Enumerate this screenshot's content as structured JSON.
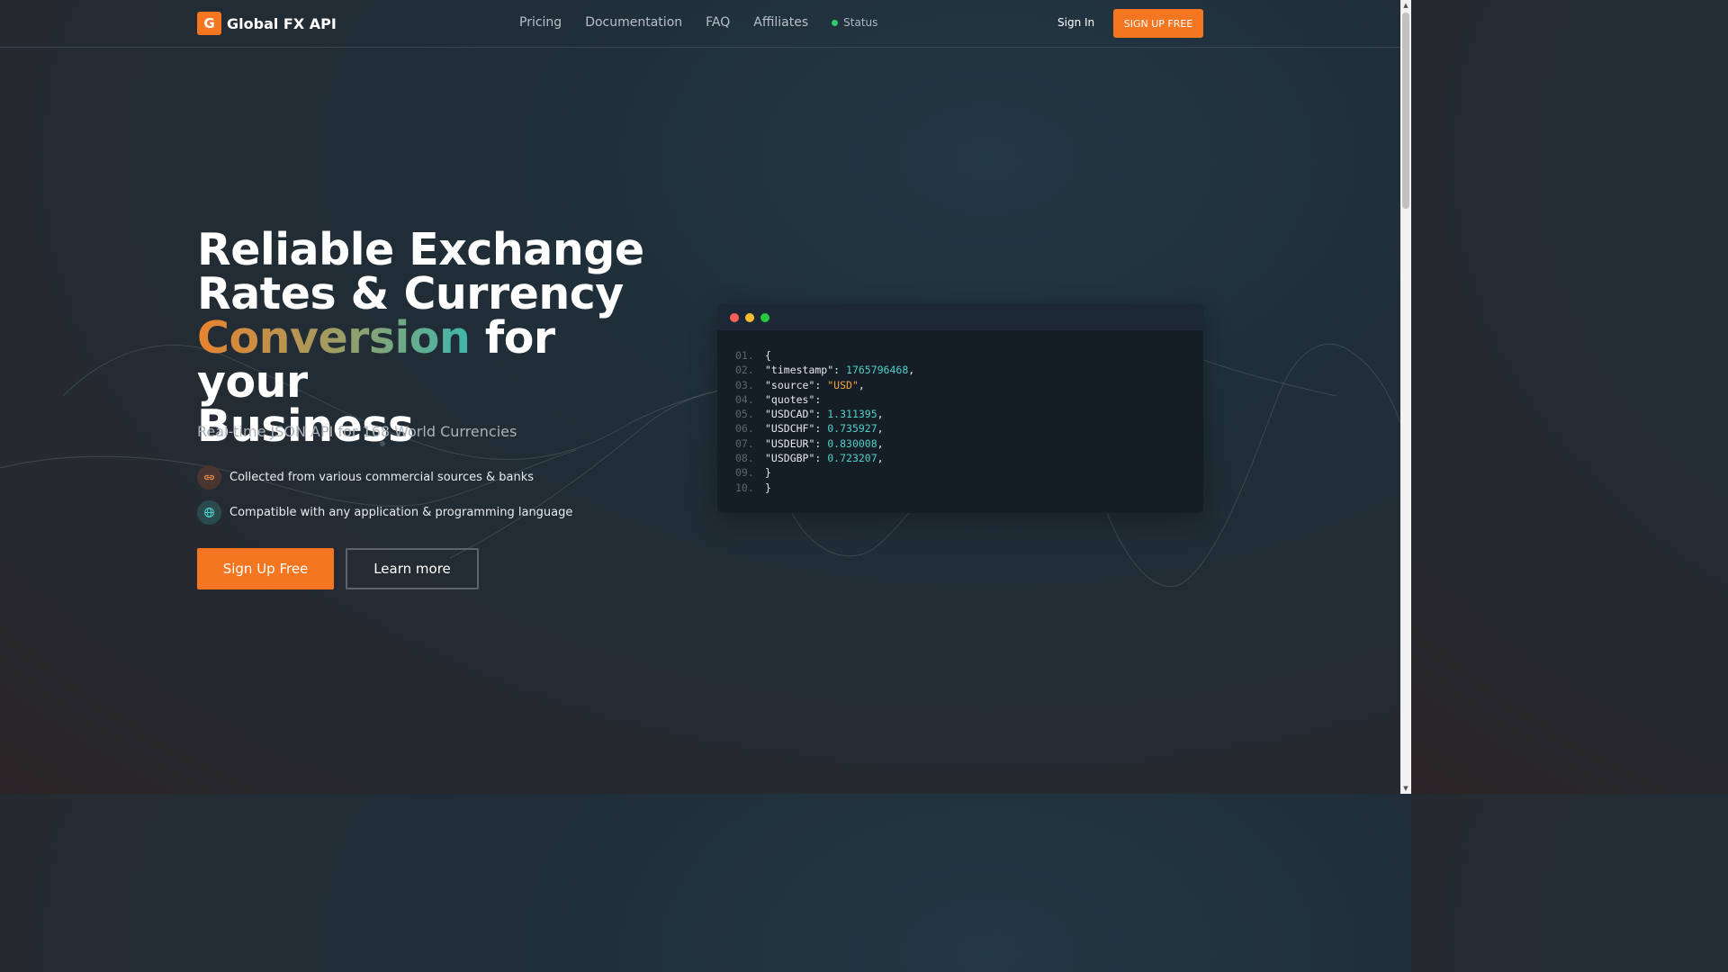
{
  "brand": {
    "logo_letter": "G",
    "name": "Global FX API",
    "accent": "#f47621"
  },
  "nav": {
    "items": [
      {
        "label": "Pricing"
      },
      {
        "label": "Documentation"
      },
      {
        "label": "FAQ"
      },
      {
        "label": "Affiliates"
      }
    ],
    "status_label": "Status",
    "status_color": "#2ecc71",
    "sign_in": "Sign In",
    "sign_up": "SIGN UP FREE"
  },
  "hero": {
    "title_line1": "Reliable Exchange",
    "title_line2": "Rates & Currency",
    "title_highlight": "Conversion",
    "title_line3_rest": " for your",
    "title_line4": "Business",
    "subtitle": "Real-time JSON API for 168 World Currencies",
    "features": [
      {
        "icon": "link-icon",
        "text": "Collected from various commercial sources & banks"
      },
      {
        "icon": "globe-icon",
        "text": "Compatible with any application & programming language"
      }
    ],
    "primary_button": "Sign Up Free",
    "secondary_button": "Learn more"
  },
  "code": {
    "lines": [
      {
        "n": "01.",
        "parts": [
          [
            "text",
            "{"
          ]
        ]
      },
      {
        "n": "02.",
        "parts": [
          [
            "text",
            "\"timestamp\": "
          ],
          [
            "num",
            "1765796468"
          ],
          [
            "text",
            ","
          ]
        ]
      },
      {
        "n": "03.",
        "parts": [
          [
            "text",
            "\"source\": "
          ],
          [
            "str",
            "\"USD\""
          ],
          [
            "text",
            ","
          ]
        ]
      },
      {
        "n": "04.",
        "parts": [
          [
            "text",
            "\"quotes\":"
          ]
        ]
      },
      {
        "n": "05.",
        "parts": [
          [
            "text",
            "\"USDCAD\": "
          ],
          [
            "num",
            "1.311395"
          ],
          [
            "text",
            ","
          ]
        ]
      },
      {
        "n": "06.",
        "parts": [
          [
            "text",
            "\"USDCHF\": "
          ],
          [
            "num",
            "0.735927"
          ],
          [
            "text",
            ","
          ]
        ]
      },
      {
        "n": "07.",
        "parts": [
          [
            "text",
            "\"USDEUR\": "
          ],
          [
            "num",
            "0.830008"
          ],
          [
            "text",
            ","
          ]
        ]
      },
      {
        "n": "08.",
        "parts": [
          [
            "text",
            "\"USDGBP\": "
          ],
          [
            "num",
            "0.723207"
          ],
          [
            "text",
            ","
          ]
        ]
      },
      {
        "n": "09.",
        "parts": [
          [
            "text",
            "}"
          ]
        ]
      },
      {
        "n": "10.",
        "parts": [
          [
            "text",
            "}"
          ]
        ]
      }
    ]
  }
}
